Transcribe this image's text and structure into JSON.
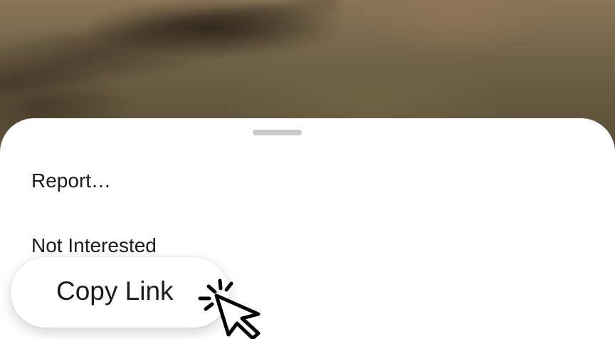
{
  "sheet": {
    "items": [
      {
        "label": "Report…"
      },
      {
        "label": "Not Interested"
      }
    ]
  },
  "highlight": {
    "label": "Copy Link"
  },
  "icons": {
    "cursor": "pointer-cursor-click-icon",
    "grabber": "drag-handle-icon"
  },
  "colors": {
    "sheet_background": "#ffffff",
    "text": "#1b1b1b",
    "grabber": "#c9c9c9"
  }
}
